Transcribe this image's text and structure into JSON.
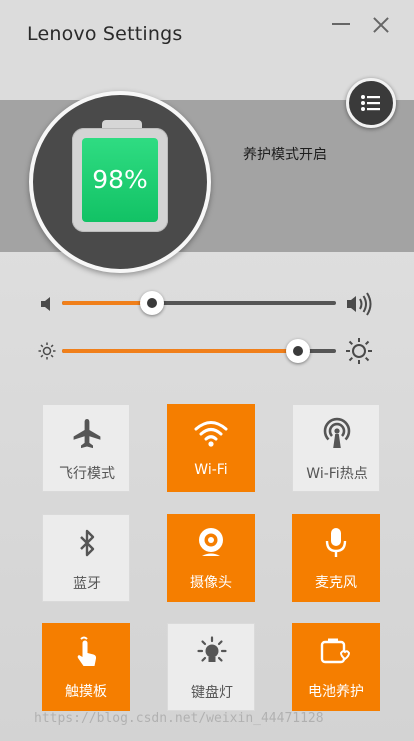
{
  "window": {
    "title": "Lenovo Settings"
  },
  "battery": {
    "level_text": "98%",
    "level": 0.98,
    "status_text": "养护模式开启"
  },
  "volume": {
    "level": 0.33
  },
  "brightness": {
    "level": 0.86
  },
  "colors": {
    "accent": "#f57e00",
    "tile_off": "#ececec",
    "battery_green": "#19c86c",
    "dark": "#3a3a3a"
  },
  "tiles": [
    {
      "label": "飞行模式",
      "icon": "airplane-icon",
      "active": false
    },
    {
      "label": "Wi-Fi",
      "icon": "wifi-icon",
      "active": true
    },
    {
      "label": "Wi-Fi热点",
      "icon": "hotspot-icon",
      "active": false
    },
    {
      "label": "蓝牙",
      "icon": "bluetooth-icon",
      "active": false
    },
    {
      "label": "摄像头",
      "icon": "camera-icon",
      "active": true
    },
    {
      "label": "麦克风",
      "icon": "microphone-icon",
      "active": true
    },
    {
      "label": "触摸板",
      "icon": "touchpad-icon",
      "active": true
    },
    {
      "label": "键盘灯",
      "icon": "keyboard-light-icon",
      "active": false
    },
    {
      "label": "电池养护",
      "icon": "battery-care-icon",
      "active": true
    }
  ],
  "watermark": "https://blog.csdn.net/weixin_44471128"
}
